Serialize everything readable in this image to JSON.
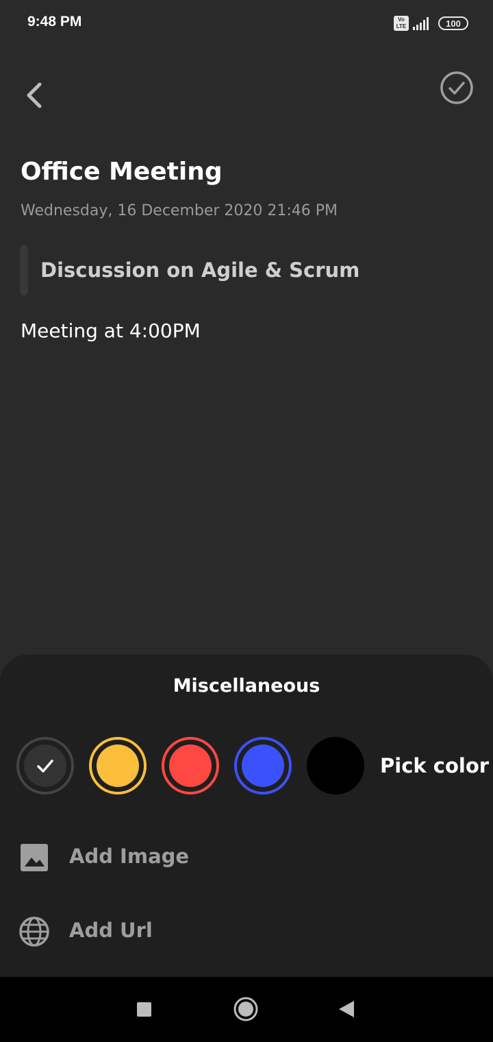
{
  "status_bar": {
    "time": "9:48 PM",
    "volte_top": "Vo",
    "volte_bottom": "LTE",
    "battery": "100"
  },
  "header": {
    "back_icon": "chevron-left-icon",
    "done_icon": "check-circle-icon"
  },
  "note": {
    "title": "Office Meeting",
    "date": "Wednesday, 16 December 2020 21:46 PM",
    "subtitle": "Discussion on Agile & Scrum",
    "body": "Meeting at 4:00PM"
  },
  "sheet": {
    "title": "Miscellaneous",
    "colors": [
      {
        "name": "default",
        "hex": "#333333",
        "ring": "#444444",
        "selected": true
      },
      {
        "name": "yellow",
        "hex": "#fdbe3b",
        "ring": "#fdbe3b",
        "selected": false
      },
      {
        "name": "red",
        "hex": "#ff4842",
        "ring": "#ff4842",
        "selected": false
      },
      {
        "name": "blue",
        "hex": "#3a52fc",
        "ring": "#3a52fc",
        "selected": false
      },
      {
        "name": "black",
        "hex": "#000000",
        "ring": "#000000",
        "selected": false
      }
    ],
    "pick_color_label": "Pick color",
    "add_image_label": "Add Image",
    "add_url_label": "Add Url"
  },
  "colors": {
    "background": "#2a2a2a",
    "sheet_background": "#1f1f1f",
    "secondary_text": "#9a9a9a"
  }
}
